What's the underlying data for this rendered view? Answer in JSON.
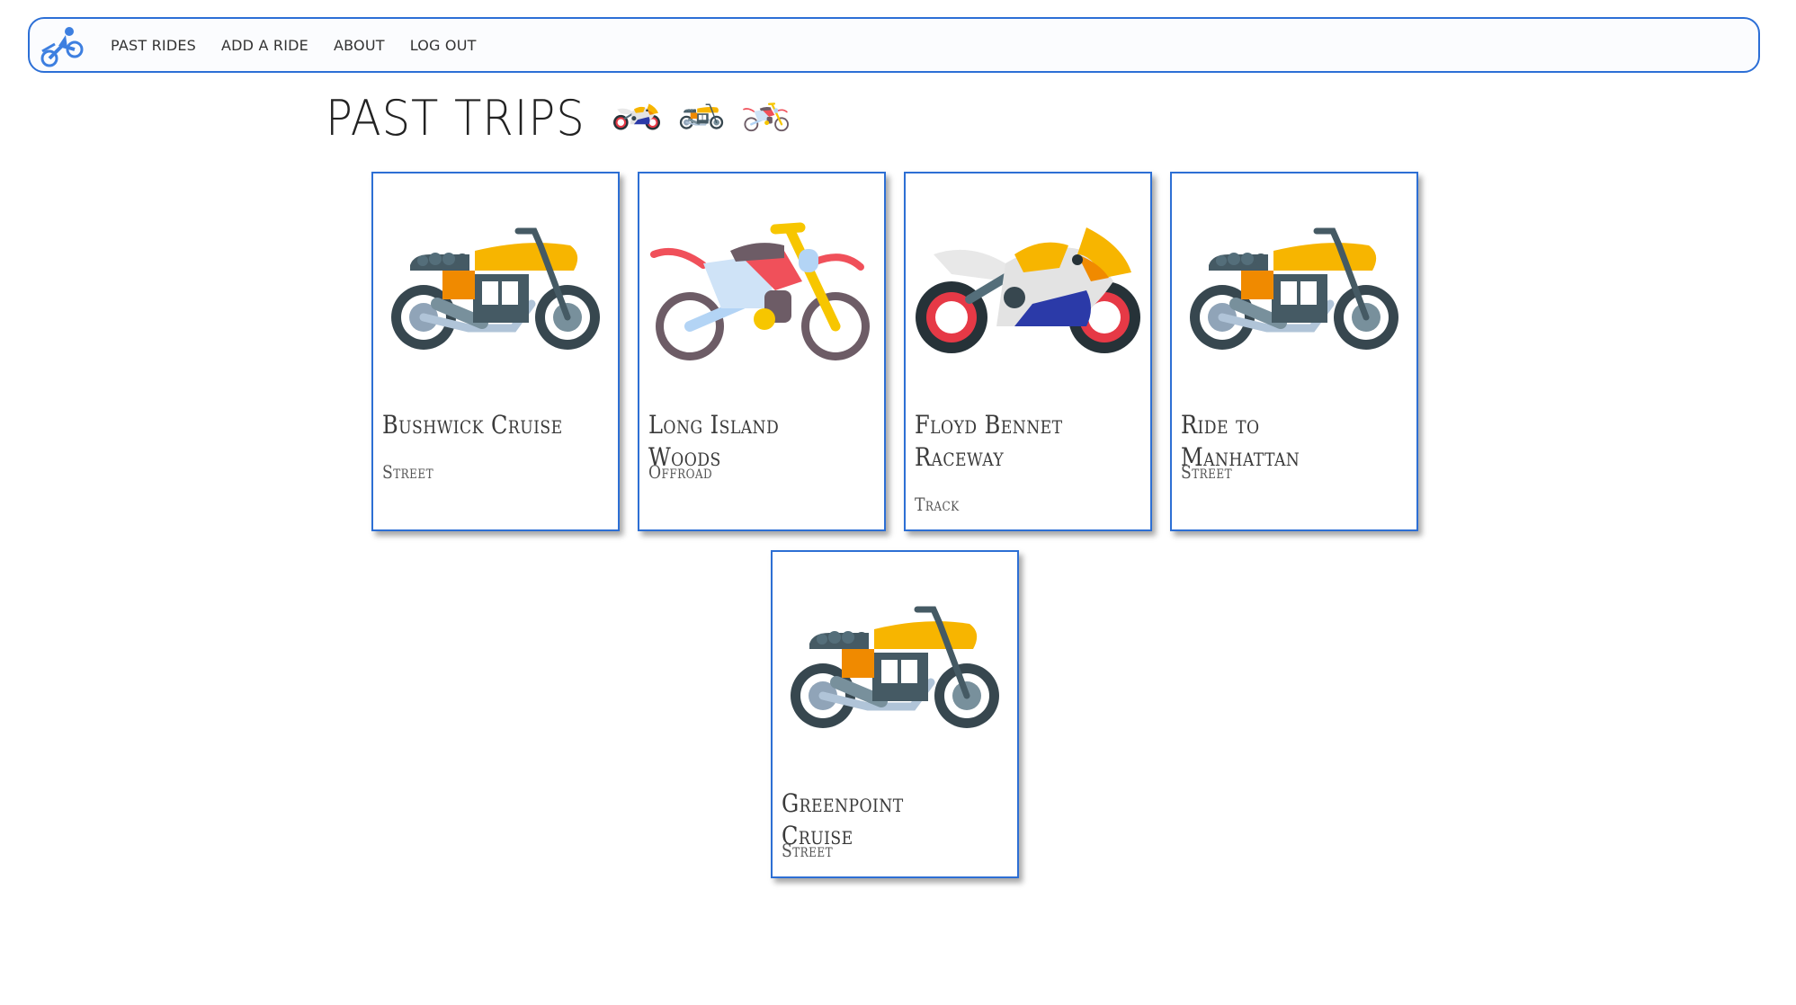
{
  "nav": {
    "logo_icon": "motorcycle-rider-logo-icon",
    "links": [
      "PAST RIDES",
      "ADD A RIDE",
      "ABOUT",
      "LOG OUT"
    ]
  },
  "page": {
    "title": "PAST TRIPS",
    "title_icons": [
      "sportbike-icon",
      "cafe-racer-icon",
      "dirtbike-icon"
    ]
  },
  "rides": [
    {
      "name": "Bushwick Cruise",
      "type": "Street",
      "icon": "cafe-racer-icon"
    },
    {
      "name": "Long Island Woods",
      "type": "Offroad",
      "icon": "dirtbike-icon"
    },
    {
      "name": "Floyd Bennet Raceway",
      "type": "Track",
      "icon": "sportbike-icon"
    },
    {
      "name": "Ride to Manhattan",
      "type": "Street",
      "icon": "cafe-racer-icon"
    },
    {
      "name": "Greenpoint Cruise",
      "type": "Street",
      "icon": "cafe-racer-icon"
    }
  ],
  "colors": {
    "accent": "#2c6fd6",
    "tank_yellow": "#f7b500",
    "tank_orange": "#f08a00",
    "wheel_dark": "#37474f",
    "dirt_red": "#f0505a",
    "sport_blue": "#2b3aa8"
  }
}
